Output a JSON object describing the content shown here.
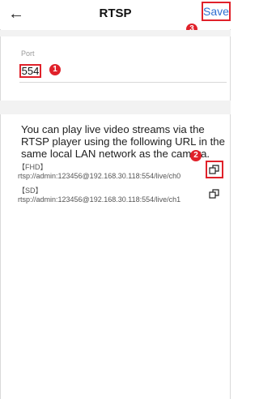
{
  "header": {
    "back_icon": "arrow-left-icon",
    "title": "RTSP",
    "save_label": "Save"
  },
  "badges": {
    "save": "3",
    "port": "1",
    "copy": "2"
  },
  "port": {
    "label": "Port",
    "value": "554"
  },
  "info": {
    "description": "You can play live video streams via the RTSP player using the following URL in the same local LAN network as the camera.",
    "urls": [
      {
        "label": "【FHD】rtsp://admin:123456@192.168.30.118:554/live/ch0",
        "copy_icon": "copy-icon"
      },
      {
        "label": "【SD】rtsp://admin:123456@192.168.30.118:554/live/ch1",
        "copy_icon": "copy-icon"
      }
    ]
  },
  "colors": {
    "accent_red": "#e0212a",
    "link_blue": "#2f6fd1",
    "band_gray": "#f2f2f2"
  }
}
